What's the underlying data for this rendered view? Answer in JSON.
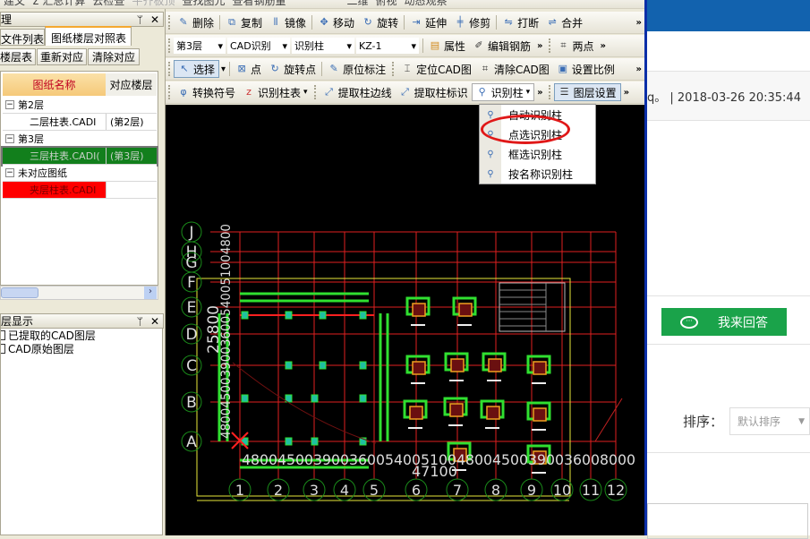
{
  "top_toolbar": {
    "items": [
      "建文",
      "Σ 汇总计算",
      "云检查",
      "平齐板顶",
      "查找图元",
      "查看钢筋量",
      "二维",
      "俯视",
      "动态观察"
    ]
  },
  "toolbar_row1": {
    "items": [
      {
        "icon": "eraser-icon",
        "label": "删除"
      },
      {
        "icon": "copy-icon",
        "label": "复制"
      },
      {
        "icon": "mirror-icon",
        "label": "镜像"
      },
      {
        "icon": "move-icon",
        "label": "移动"
      },
      {
        "icon": "rotate-icon",
        "label": "旋转"
      },
      {
        "icon": "extend-icon",
        "label": "延伸"
      },
      {
        "icon": "trim-icon",
        "label": "修剪"
      },
      {
        "icon": "break-icon",
        "label": "打断"
      },
      {
        "icon": "merge-icon",
        "label": "合并"
      }
    ],
    "more": "»"
  },
  "toolbar_row2": {
    "floor": "第3层",
    "mode": "CAD识别",
    "type": "识别柱",
    "component": "KZ-1",
    "items": [
      {
        "icon": "properties-icon",
        "label": "属性"
      },
      {
        "icon": "edit-rebar-icon",
        "label": "编辑钢筋"
      },
      {
        "icon": "two-point-icon",
        "label": "两点"
      }
    ],
    "more": "»"
  },
  "toolbar_row3": {
    "items": [
      {
        "icon": "cursor-icon",
        "label": "选择"
      },
      {
        "icon": "point-icon",
        "label": "点"
      },
      {
        "icon": "rotate-point-icon",
        "label": "旋转点"
      },
      {
        "icon": "in-place-annotation-icon",
        "label": "原位标注"
      },
      {
        "icon": "locate-cad-icon",
        "label": "定位CAD图"
      },
      {
        "icon": "clear-cad-icon",
        "label": "清除CAD图"
      },
      {
        "icon": "set-scale-icon",
        "label": "设置比例"
      }
    ],
    "more": "»"
  },
  "toolbar_row4": {
    "items": [
      {
        "icon": "convert-symbol-icon",
        "label": "转换符号"
      },
      {
        "icon": "identify-column-table-icon",
        "label": "识别柱表"
      },
      {
        "icon": "extract-column-edge-icon",
        "label": "提取柱边线"
      },
      {
        "icon": "extract-column-label-icon",
        "label": "提取柱标识"
      },
      {
        "icon": "identify-column-icon",
        "label": "识别柱"
      },
      {
        "icon": "layer-settings-icon",
        "label": "图层设置"
      }
    ],
    "more": "»"
  },
  "dropdown_menu": {
    "items": [
      "自动识别柱",
      "点选识别柱",
      "框选识别柱",
      "按名称识别柱"
    ],
    "highlighted": "点选识别柱"
  },
  "left_panel": {
    "title": "理",
    "tabs": [
      "文件列表",
      "图纸楼层对照表"
    ],
    "active_tab": "图纸楼层对照表",
    "buttons": [
      "楼层表",
      "重新对应",
      "清除对应"
    ],
    "columns": [
      "图纸名称",
      "对应楼层"
    ],
    "rows": [
      {
        "kind": "group",
        "name": "第2层"
      },
      {
        "kind": "file",
        "name": "二层柱表.CADI",
        "floor": "(第2层)",
        "status": "normal"
      },
      {
        "kind": "group",
        "name": "第3层"
      },
      {
        "kind": "file",
        "name": "三层柱表.CADI(",
        "floor": "(第3层)",
        "status": "selected"
      },
      {
        "kind": "group",
        "name": "未对应图纸"
      },
      {
        "kind": "file",
        "name": "夹层柱表.CADI",
        "floor": "",
        "status": "unmatched"
      }
    ],
    "colors": {
      "selected": "#127f1c",
      "unmatched": "#ff0000",
      "header": "#f8d38a"
    }
  },
  "layer_panel": {
    "title": "层显示",
    "items": [
      "已提取的CAD图层",
      "CAD原始图层"
    ]
  },
  "cad": {
    "row_axes": [
      "J",
      "H",
      "G",
      "F",
      "E",
      "D",
      "C",
      "B",
      "A"
    ],
    "col_axes": [
      "1",
      "2",
      "3",
      "4",
      "5",
      "6",
      "7",
      "8",
      "9",
      "10",
      "11",
      "12"
    ],
    "dim_total_x": "47100",
    "dim_total_y": "25800",
    "dim_chain_x": "48004500390036005400510048004500390036008000",
    "dim_chain_y": "4800450039003600540051004800"
  },
  "web": {
    "meta_text": "q。 | 2018-03-26 20:35:44",
    "answer_button": "我来回答",
    "sort_label": "排序：",
    "sort_value": "默认排序",
    "colors": {
      "header": "#1262ae",
      "answer": "#1aa34a"
    }
  }
}
